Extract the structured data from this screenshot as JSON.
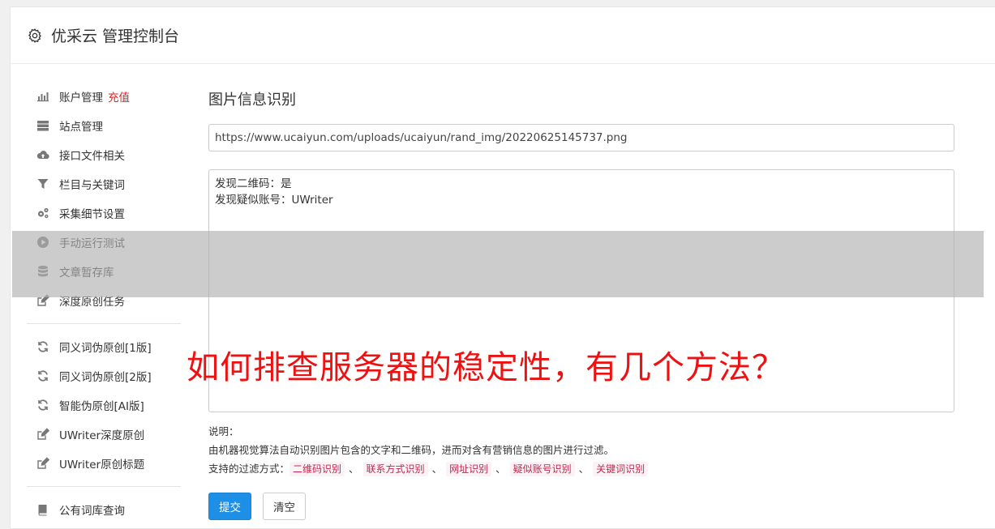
{
  "header": {
    "title": "优采云 管理控制台",
    "icon": "gear-icon"
  },
  "sidebar": {
    "group1": [
      {
        "label": "账户管理",
        "badge": "充值",
        "icon": "bar-chart-icon"
      },
      {
        "label": "站点管理",
        "icon": "server-icon"
      },
      {
        "label": "接口文件相关",
        "icon": "cloud-upload-icon"
      },
      {
        "label": "栏目与关键词",
        "icon": "filter-icon"
      },
      {
        "label": "采集细节设置",
        "icon": "gears-icon"
      },
      {
        "label": "手动运行测试",
        "icon": "play-icon"
      },
      {
        "label": "文章暂存库",
        "icon": "database-icon"
      },
      {
        "label": "深度原创任务",
        "icon": "edit-icon"
      }
    ],
    "group2": [
      {
        "label": "同义词伪原创[1版]",
        "icon": "refresh-icon"
      },
      {
        "label": "同义词伪原创[2版]",
        "icon": "refresh-icon"
      },
      {
        "label": "智能伪原创[AI版]",
        "icon": "refresh-icon"
      },
      {
        "label": "UWriter深度原创",
        "icon": "edit-icon"
      },
      {
        "label": "UWriter原创标题",
        "icon": "edit-icon"
      }
    ],
    "group3": [
      {
        "label": "公有词库查询",
        "icon": "book-icon"
      }
    ]
  },
  "main": {
    "title": "图片信息识别",
    "url_value": "https://www.ucaiyun.com/uploads/ucaiyun/rand_img/20220625145737.png",
    "result_lines": [
      "发现二维码：是",
      "发现疑似账号：UWriter"
    ],
    "notes_label": "说明：",
    "notes_desc": "由机器视觉算法自动识别图片包含的文字和二维码，进而对含有营销信息的图片进行过滤。",
    "filter_label": "支持的过滤方式：",
    "filters": [
      "二维码识别",
      "联系方式识别",
      "网址识别",
      "疑似账号识别",
      "关键词识别"
    ],
    "filter_sep": "、",
    "submit_label": "提交",
    "clear_label": "清空"
  },
  "overlay": {
    "text": "如何排查服务器的稳定性，有几个方法？"
  },
  "colors": {
    "primary": "#1e8fe6",
    "badge_red": "#e02020",
    "tag_text": "#c7254e",
    "overlay_text": "#ee1111"
  }
}
